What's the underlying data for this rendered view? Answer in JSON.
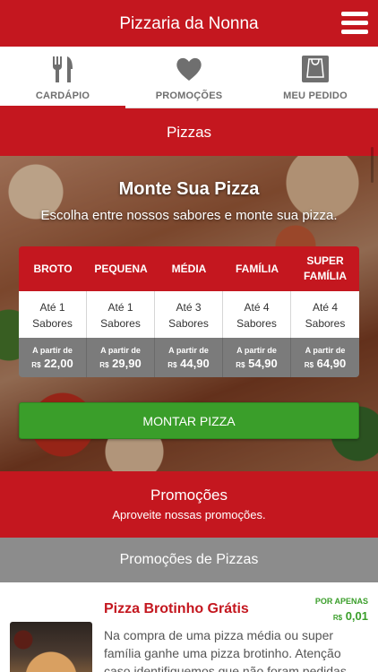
{
  "header": {
    "title": "Pizzaria da Nonna",
    "menu_icon": "hamburger-menu-icon"
  },
  "tabs": [
    {
      "label": "CARDÁPIO",
      "icon": "fork-knife-icon",
      "active": true
    },
    {
      "label": "PROMOÇÕES",
      "icon": "heart-icon",
      "active": false
    },
    {
      "label": "MEU PEDIDO",
      "icon": "shopping-bag-icon",
      "active": false
    }
  ],
  "pizzas_section": {
    "title": "Pizzas"
  },
  "build_pizza": {
    "title": "Monte Sua Pizza",
    "subtitle": "Escolha entre nossos sabores e monte sua pizza.",
    "sizes": [
      {
        "name": "BROTO",
        "flavors_line1": "Até 1",
        "flavors_line2": "Sabores",
        "from_label": "A partir de",
        "currency": "R$",
        "price": "22,00"
      },
      {
        "name": "PEQUENA",
        "flavors_line1": "Até 1",
        "flavors_line2": "Sabores",
        "from_label": "A partir de",
        "currency": "R$",
        "price": "29,90"
      },
      {
        "name": "MÉDIA",
        "flavors_line1": "Até 3",
        "flavors_line2": "Sabores",
        "from_label": "A partir de",
        "currency": "R$",
        "price": "44,90"
      },
      {
        "name": "FAMÍLIA",
        "flavors_line1": "Até 4",
        "flavors_line2": "Sabores",
        "from_label": "A partir de",
        "currency": "R$",
        "price": "54,90"
      },
      {
        "name_line1": "SUPER",
        "name_line2": "FAMÍLIA",
        "flavors_line1": "Até 4",
        "flavors_line2": "Sabores",
        "from_label": "A partir de",
        "currency": "R$",
        "price": "64,90"
      }
    ],
    "button_label": "MONTAR PIZZA"
  },
  "promotions": {
    "title": "Promoções",
    "subtitle": "Aproveite nossas promoções.",
    "category_title": "Promoções de Pizzas",
    "items": [
      {
        "name": "Pizza Brotinho Grátis",
        "tag": "POR APENAS",
        "currency": "R$",
        "price": "0,01",
        "description": "Na compra de uma pizza média ou super família ganhe uma pizza brotinho. Atenção caso identifiquemos que não foram pedidas"
      }
    ]
  },
  "colors": {
    "brand_red": "#c4171f",
    "button_green": "#3a9e2a",
    "gray_bar": "#8c8c8c",
    "price_gray": "#7b7b7b"
  }
}
